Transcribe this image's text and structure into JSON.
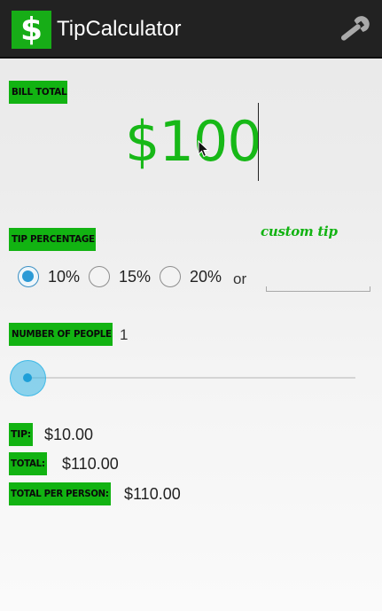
{
  "app": {
    "title": "TipCalculator",
    "logo_text": "$",
    "settings_icon": "wrench-icon"
  },
  "bill": {
    "label": "BILL TOTAL",
    "value": "$100"
  },
  "tip": {
    "label": "TIP PERCENTAGE",
    "custom_hint": "custom tip",
    "options": [
      {
        "label": "10%",
        "selected": true
      },
      {
        "label": "15%",
        "selected": false
      },
      {
        "label": "20%",
        "selected": false
      }
    ],
    "or_text": "or",
    "custom_value": ""
  },
  "people": {
    "label": "NUMBER OF PEOPLE",
    "count": "1",
    "slider_value": 1
  },
  "results": {
    "tip_label": "TIP:",
    "tip_value": "$10.00",
    "total_label": "TOTAL:",
    "total_value": "$110.00",
    "per_person_label": "TOTAL PER PERSON:",
    "per_person_value": "$110.00"
  },
  "colors": {
    "accent_green": "#12b312",
    "action_bar": "#222222",
    "holo_blue": "#33b5e5"
  }
}
